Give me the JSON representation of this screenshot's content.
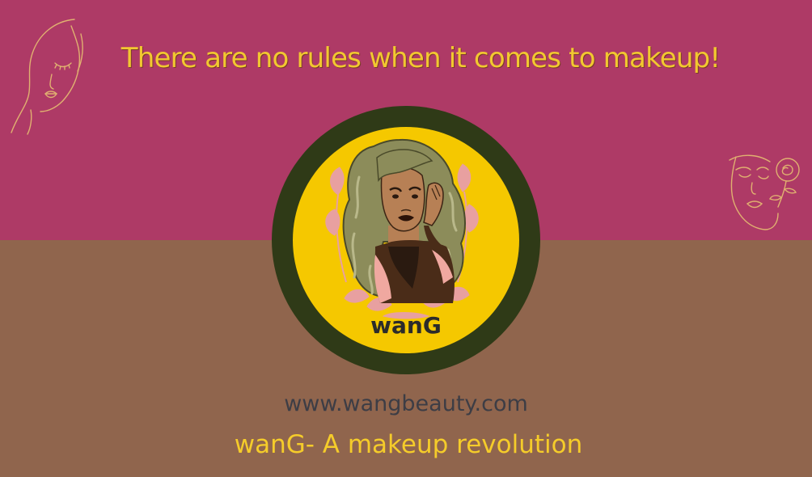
{
  "headline": "There are no rules when it comes to makeup!",
  "logo": {
    "brand": "wanG"
  },
  "footer": {
    "url": "www.wangbeauty.com",
    "tagline": "wanG- A makeup revolution"
  },
  "colors": {
    "top_background": "#ae3a66",
    "bottom_background": "#90654d",
    "accent_yellow": "#f5c800",
    "logo_ring": "#2f3a17",
    "url_text": "#3d3d45"
  },
  "icons": [
    "face-lineart-icon",
    "face-rose-lineart-icon"
  ]
}
